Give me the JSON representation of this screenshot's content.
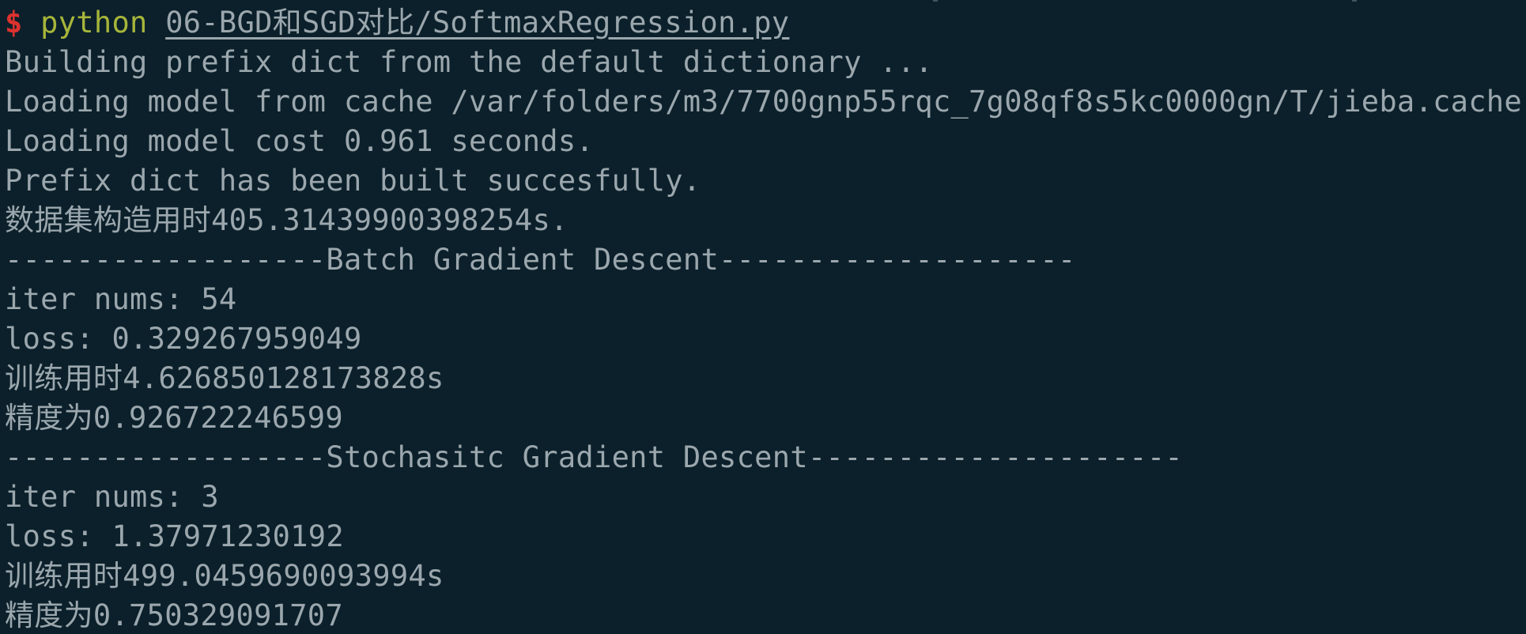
{
  "terminal": {
    "prompt_symbol": "$",
    "command": "python",
    "script_path": "06-BGD和SGD对比/SoftmaxRegression.py",
    "output_lines": [
      "Building prefix dict from the default dictionary ...",
      "Loading model from cache /var/folders/m3/7700gnp55rqc_7g08qf8s5kc0000gn/T/jieba.cache",
      "Loading model cost 0.961 seconds.",
      "Prefix dict has been built succesfully.",
      "数据集构造用时405.31439900398254s.",
      "------------------Batch Gradient Descent--------------------",
      "iter nums: 54",
      "loss: 0.329267959049",
      "训练用时4.626850128173828s",
      "精度为0.926722246599",
      "------------------Stochasitc Gradient Descent---------------------",
      "iter nums: 3",
      "loss: 1.37971230192",
      "训练用时499.0459690093994s",
      "精度为0.750329091707"
    ]
  },
  "colors": {
    "background": "#0b202b",
    "text": "#9ba7ad",
    "prompt": "#dc322f",
    "command": "#a7b53a"
  }
}
